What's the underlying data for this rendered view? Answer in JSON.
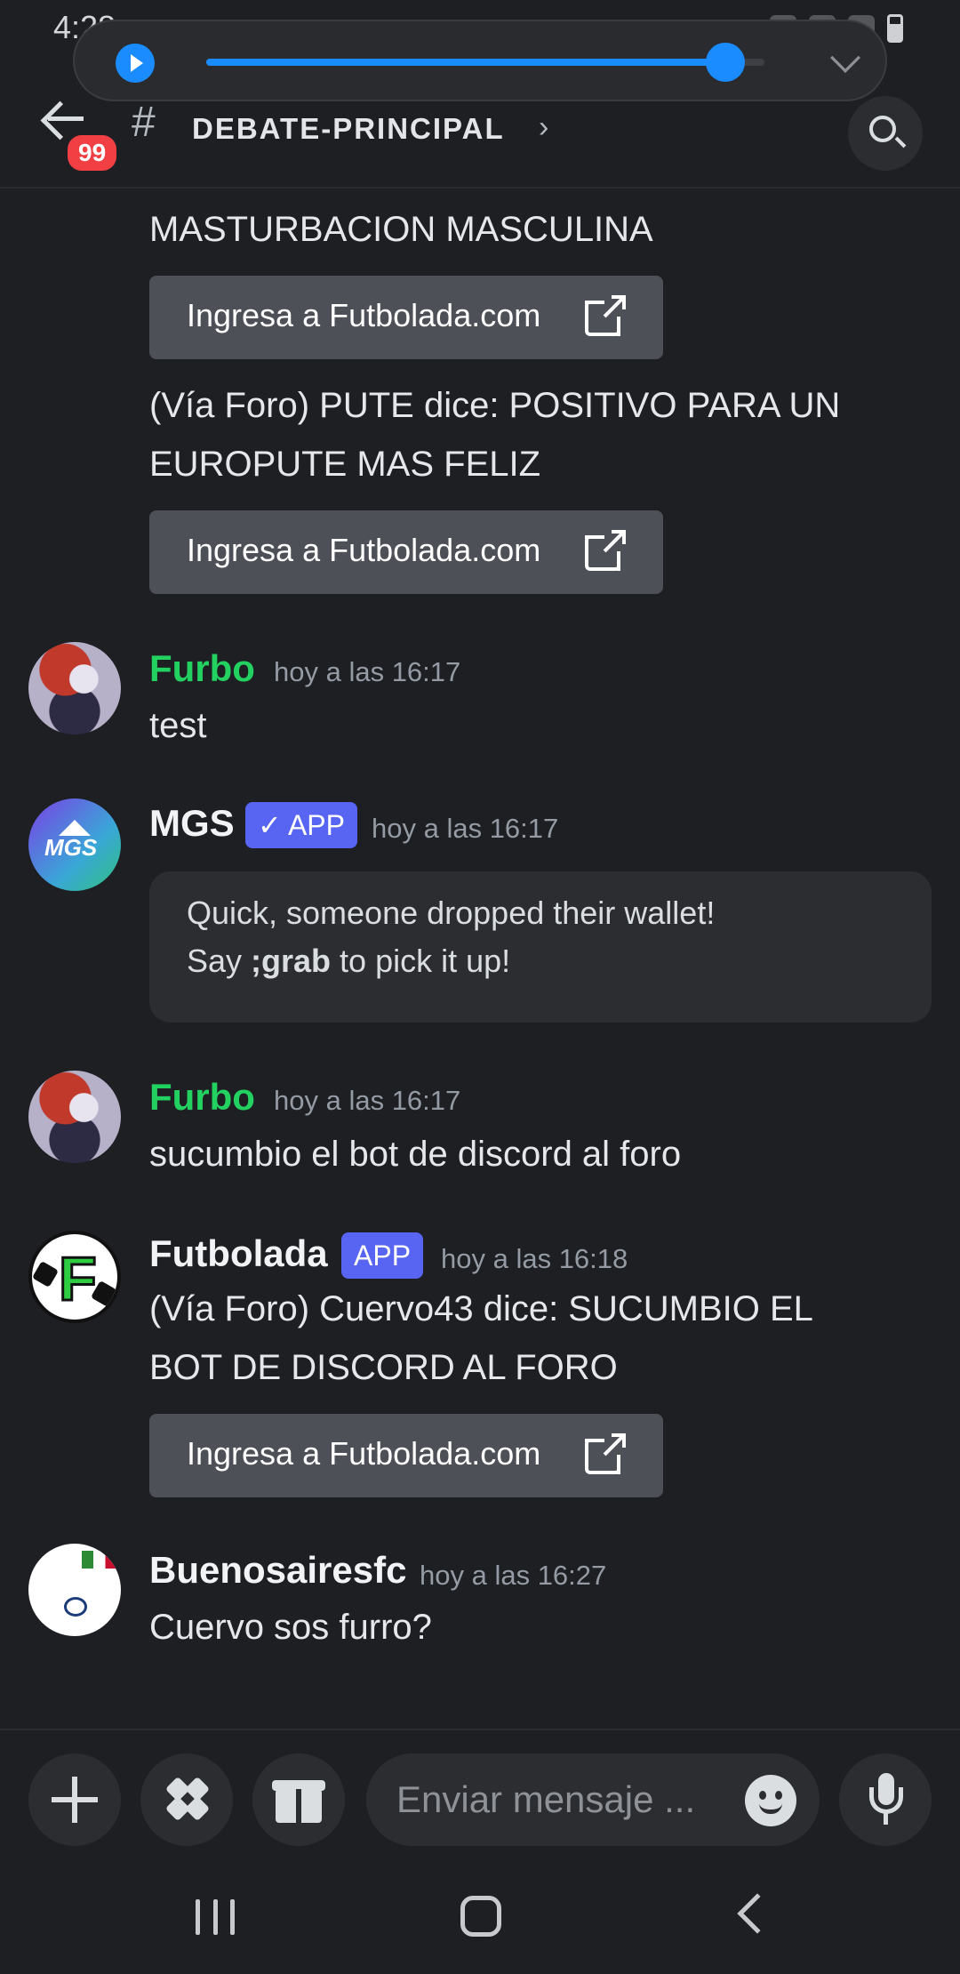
{
  "status_bar": {
    "time": "4:28"
  },
  "media_player": {
    "progress": 0.93
  },
  "header": {
    "back_badge": "99",
    "channel_hash": "#",
    "channel_name": "DEBATE-PRINCIPAL",
    "channel_chevron": "›"
  },
  "messages": {
    "partial_top": {
      "line1": "MASTURBACION MASCULINA",
      "button": "Ingresa a Futbolada.com",
      "line2": "(Vía Foro) PUTE dice: POSITIVO PARA UN",
      "line3": "EUROPUTE MAS FELIZ",
      "button2": "Ingresa a Futbolada.com"
    },
    "m1": {
      "author": "Furbo",
      "time": "hoy a las 16:17",
      "text": "test",
      "color": "#23d160"
    },
    "m2": {
      "author": "MGS",
      "badge": "✓ APP",
      "time": "hoy a las 16:17",
      "avatar_text": "MGS",
      "embed_line1": "Quick, someone dropped their wallet!",
      "embed_line2_pre": "Say ",
      "embed_line2_bold": ";grab",
      "embed_line2_post": " to pick it up!"
    },
    "m3": {
      "author": "Furbo",
      "time": "hoy a las 16:17",
      "text": "sucumbio el bot de discord al foro"
    },
    "m4": {
      "author": "Futbolada",
      "badge": "APP",
      "time": "hoy a las 16:18",
      "avatar_text": "F",
      "line1": "(Vía Foro) Cuervo43 dice: SUCUMBIO EL",
      "line2": "BOT DE DISCORD AL FORO",
      "button": "Ingresa a Futbolada.com"
    },
    "m5": {
      "author": "Buenosairesfc",
      "time": "hoy a las 16:27",
      "text": "Cuervo sos furro?"
    }
  },
  "composer": {
    "placeholder": "Enviar mensaje ..."
  },
  "colors": {
    "accent": "#5865f2",
    "green_name": "#23d160",
    "media_blue": "#1a8cff",
    "badge_red": "#f23f43"
  }
}
